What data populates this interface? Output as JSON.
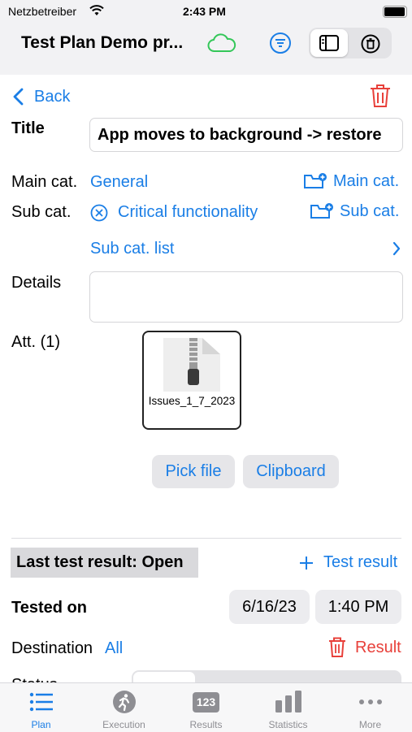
{
  "status": {
    "carrier": "Netzbetreiber",
    "time": "2:43 PM"
  },
  "nav": {
    "title": "Test Plan Demo pr..."
  },
  "toolbar": {
    "back": "Back"
  },
  "form": {
    "title_label": "Title",
    "title_value": "App moves to background -> restore",
    "main_cat_label": "Main cat.",
    "main_cat_value": "General",
    "main_cat_button": "Main cat.",
    "sub_cat_label": "Sub cat.",
    "sub_cat_value": "Critical functionality",
    "sub_cat_button": "Sub cat.",
    "sub_cat_list": "Sub cat. list",
    "details_label": "Details",
    "details_value": "",
    "att_label": "Att. (1)",
    "attachment_name": "Issues_1_7_2023",
    "pick_file": "Pick file",
    "clipboard": "Clipboard"
  },
  "result": {
    "last_label": "Last test result:  Open",
    "add_result": "Test result",
    "tested_on_label": "Tested on",
    "date": "6/16/23",
    "time": "1:40 PM",
    "destination_label": "Destination",
    "destination_value": "All",
    "result_button": "Result",
    "status_label": "Status"
  },
  "tabs": [
    {
      "label": "Plan",
      "icon": "list-icon",
      "active": true
    },
    {
      "label": "Execution",
      "icon": "runner-icon",
      "active": false
    },
    {
      "label": "Results",
      "icon": "numbers-icon",
      "active": false
    },
    {
      "label": "Statistics",
      "icon": "bar-chart-icon",
      "active": false
    },
    {
      "label": "More",
      "icon": "ellipsis-icon",
      "active": false
    }
  ],
  "colors": {
    "accent": "#1a7ee6",
    "destructive": "#e8403a",
    "cloud": "#34c759"
  }
}
